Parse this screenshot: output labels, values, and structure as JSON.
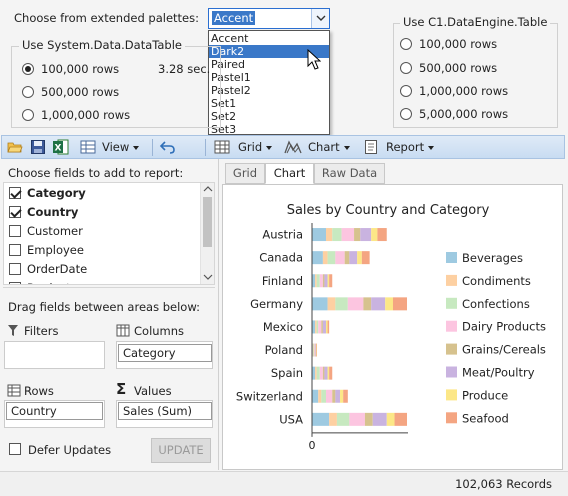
{
  "palette": {
    "label": "Choose from extended palettes:",
    "selected": "Accent",
    "options": [
      "Accent",
      "Dark2",
      "Paired",
      "Pastel1",
      "Pastel2",
      "Set1",
      "Set2",
      "Set3"
    ],
    "highlighted_index": 1
  },
  "datatable_group": {
    "title": "Use System.Data.DataTable",
    "options": [
      "100,000 rows",
      "500,000 rows",
      "1,000,000 rows"
    ],
    "selected_index": 0,
    "timing": "3.28 sec."
  },
  "dataengine_group": {
    "title": "Use C1.DataEngine.Table",
    "options": [
      "100,000 rows",
      "500,000 rows",
      "1,000,000 rows",
      "5,000,000 rows"
    ]
  },
  "toolbar": {
    "view_label": "View",
    "grid_label": "Grid",
    "chart_label": "Chart",
    "report_label": "Report",
    "icons": [
      "open-folder-icon",
      "save-icon",
      "excel-icon",
      "view-icon",
      "undo-icon",
      "grid-icon",
      "chart-icon",
      "report-icon"
    ]
  },
  "fields_panel": {
    "title": "Choose fields to add to report:",
    "fields": [
      {
        "label": "Category",
        "checked": true,
        "bold": true
      },
      {
        "label": "Country",
        "checked": true,
        "bold": true
      },
      {
        "label": "Customer",
        "checked": false,
        "bold": false
      },
      {
        "label": "Employee",
        "checked": false,
        "bold": false
      },
      {
        "label": "OrderDate",
        "checked": false,
        "bold": false
      },
      {
        "label": "Product",
        "checked": false,
        "bold": false
      }
    ],
    "drag_label": "Drag fields between areas below:",
    "filters_label": "Filters",
    "columns_label": "Columns",
    "columns_value": "Category",
    "rows_label": "Rows",
    "rows_value": "Country",
    "values_label": "Values",
    "values_value": "Sales (Sum)",
    "defer_label": "Defer Updates",
    "update_label": "UPDATE"
  },
  "tabs": [
    {
      "label": "Grid",
      "active": false
    },
    {
      "label": "Chart",
      "active": true
    },
    {
      "label": "Raw Data",
      "active": false
    }
  ],
  "status": {
    "records": "102,063 Records"
  },
  "chart_data": {
    "type": "bar",
    "orientation": "horizontal",
    "stacked": true,
    "title": "Sales by Country and Category",
    "categories": [
      "Austria",
      "Canada",
      "Finland",
      "Germany",
      "Mexico",
      "Poland",
      "Spain",
      "Switzerland",
      "USA"
    ],
    "x_tick_labels": [
      "0"
    ],
    "legend_position": "right",
    "series": [
      {
        "name": "Beverages",
        "color": "#9ecae1",
        "values": [
          0.9,
          0.7,
          0.2,
          1.0,
          0.2,
          0.05,
          0.2,
          0.4,
          1.1
        ]
      },
      {
        "name": "Condiments",
        "color": "#fdd0a2",
        "values": [
          0.4,
          0.3,
          0.1,
          0.5,
          0.1,
          0.04,
          0.1,
          0.2,
          0.5
        ]
      },
      {
        "name": "Confections",
        "color": "#c7e9c0",
        "values": [
          0.6,
          0.5,
          0.2,
          0.8,
          0.1,
          0.04,
          0.2,
          0.3,
          0.8
        ]
      },
      {
        "name": "Dairy Products",
        "color": "#fcc5e0",
        "values": [
          0.8,
          0.6,
          0.2,
          1.0,
          0.2,
          0.05,
          0.2,
          0.4,
          1.0
        ]
      },
      {
        "name": "Grains/Cereals",
        "color": "#d6c28e",
        "values": [
          0.4,
          0.3,
          0.1,
          0.5,
          0.1,
          0.03,
          0.1,
          0.2,
          0.5
        ]
      },
      {
        "name": "Meat/Poultry",
        "color": "#c9b3e0",
        "values": [
          0.7,
          0.5,
          0.2,
          0.9,
          0.2,
          0.04,
          0.2,
          0.3,
          0.9
        ]
      },
      {
        "name": "Produce",
        "color": "#fce787",
        "values": [
          0.4,
          0.3,
          0.1,
          0.5,
          0.1,
          0.03,
          0.1,
          0.2,
          0.5
        ]
      },
      {
        "name": "Seafood",
        "color": "#f4a582",
        "values": [
          0.6,
          0.5,
          0.2,
          0.9,
          0.1,
          0.04,
          0.2,
          0.3,
          0.8
        ]
      }
    ]
  }
}
